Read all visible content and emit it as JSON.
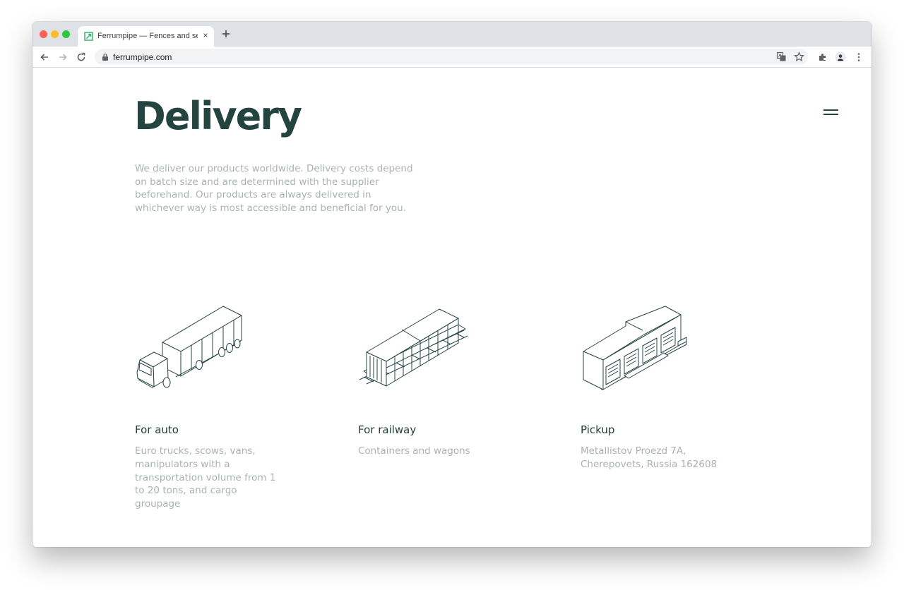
{
  "browser": {
    "tab_title": "Ferrumpipe — Fences and sections",
    "url": "ferrumpipe.com",
    "tab_close": "×"
  },
  "page": {
    "title": "Delivery",
    "intro": "We deliver our products worldwide. Delivery costs depend on batch size and are determined with the supplier beforehand. Our products are always delivered in whichever way is most accessible and beneficial for you."
  },
  "options": [
    {
      "title": "For auto",
      "text": "Euro trucks, scows, vans, manipulators with a transportation volume from 1 to 20 tons, and cargo groupage",
      "icon": "truck-icon"
    },
    {
      "title": "For railway",
      "text": "Containers and wagons",
      "icon": "railway-wagon-icon"
    },
    {
      "title": "Pickup",
      "text": "Metallistov Proezd 7A, Cherepovets, Russia 162608",
      "icon": "warehouse-icon"
    }
  ],
  "colors": {
    "heading": "#24443f",
    "muted": "#a9b3b0",
    "favicon": "#3cb371"
  }
}
